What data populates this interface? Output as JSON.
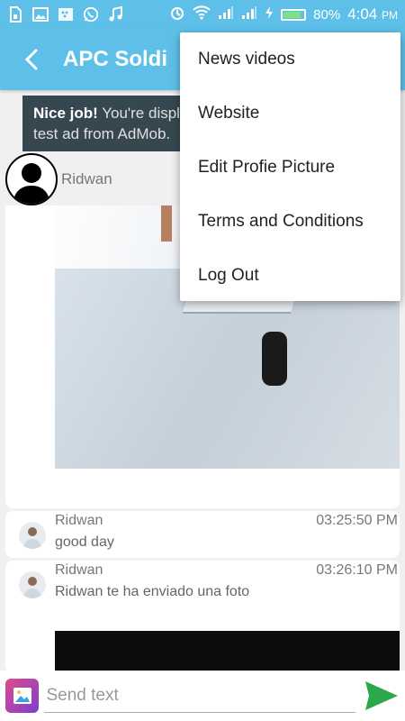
{
  "status_bar": {
    "battery_percent": "80%",
    "battery_level": 0.8,
    "time": "4:04",
    "ampm": "PM",
    "icons": [
      "sim-icon",
      "image-icon",
      "blackberry-icon",
      "whatsapp-icon",
      "music-icon",
      "alarm-icon",
      "wifi-icon",
      "signal-icon",
      "signal-icon",
      "charging-icon",
      "battery-icon"
    ]
  },
  "app_bar": {
    "title": "APC Soldi"
  },
  "ad": {
    "bold": "Nice job!",
    "text": " You're displa",
    "line2": "test ad from AdMob."
  },
  "poster": {
    "name": "Ridwan"
  },
  "messages": [
    {
      "name": "Ridwan",
      "time": "03:25:50 PM",
      "text": "good day"
    },
    {
      "name": "Ridwan",
      "time": "03:26:10 PM",
      "text": "Ridwan te ha enviado una foto"
    }
  ],
  "input": {
    "placeholder": "Send text"
  },
  "menu": {
    "items": [
      "News videos",
      "Website",
      "Edit Profie Picture",
      "Terms and Conditions",
      "Log Out"
    ]
  },
  "colors": {
    "primary": "#5ec0e8",
    "send": "#2aa84a"
  }
}
